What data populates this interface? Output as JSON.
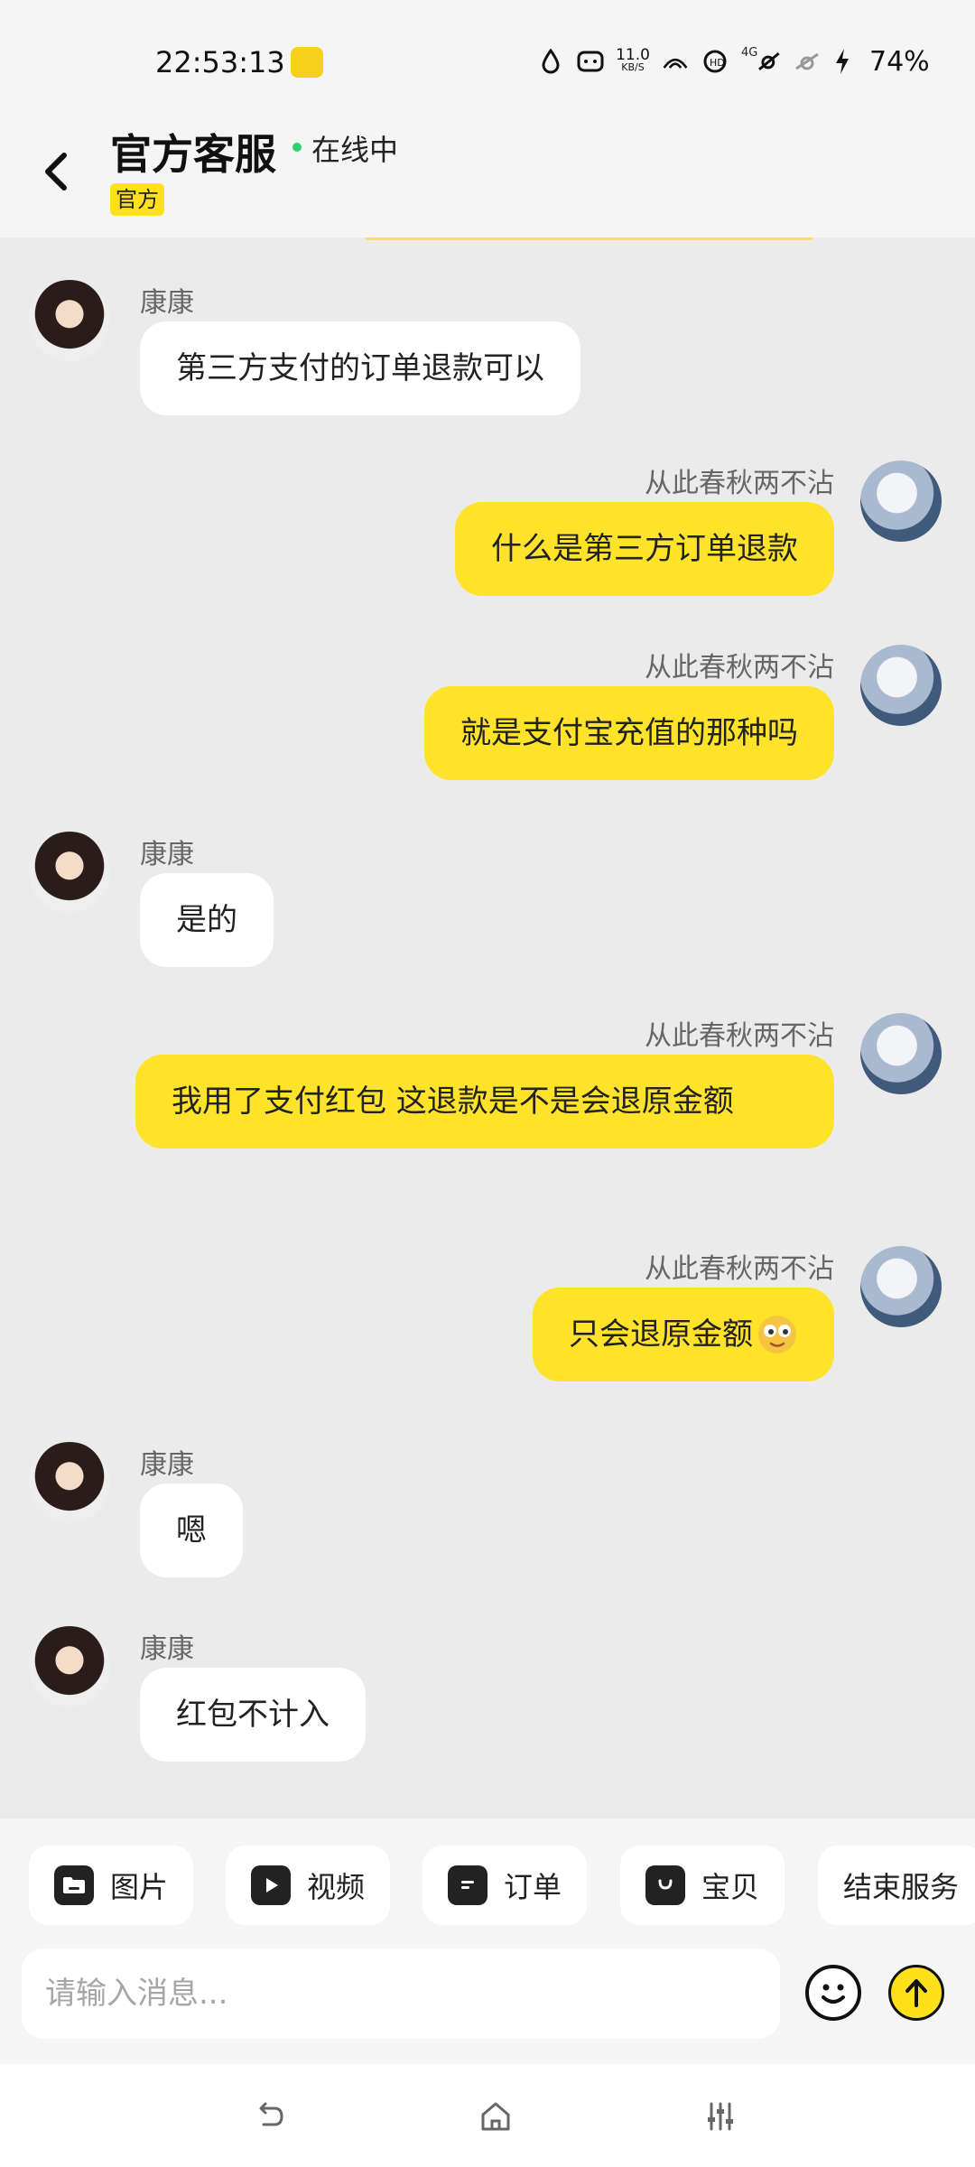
{
  "status_bar": {
    "time": "22:53:13",
    "netspeed_value": "11.0",
    "netspeed_unit": "KB/S",
    "network": "4G",
    "battery": "74%"
  },
  "header": {
    "title": "官方客服",
    "status": "在线中",
    "badge": "官方"
  },
  "messages": [
    {
      "from": "agent",
      "sender": "康康",
      "text": "第三方支付的订单退款可以"
    },
    {
      "from": "user",
      "sender": "从此春秋两不沾",
      "text": "什么是第三方订单退款"
    },
    {
      "from": "user",
      "sender": "从此春秋两不沾",
      "text": "就是支付宝充值的那种吗"
    },
    {
      "from": "agent",
      "sender": "康康",
      "text": "是的"
    },
    {
      "from": "user",
      "sender": "从此春秋两不沾",
      "text": "我用了支付红包  这退款是不是会退原金额"
    },
    {
      "from": "user",
      "sender": "从此春秋两不沾",
      "text": "只会退原金额"
    },
    {
      "from": "agent",
      "sender": "康康",
      "text": "嗯"
    },
    {
      "from": "agent",
      "sender": "康康",
      "text": "红包不计入"
    }
  ],
  "quick_actions": [
    {
      "label": "图片",
      "icon": "folder-icon"
    },
    {
      "label": "视频",
      "icon": "play-icon"
    },
    {
      "label": "订单",
      "icon": "order-icon"
    },
    {
      "label": "宝贝",
      "icon": "bag-icon"
    },
    {
      "label": "结束服务",
      "icon": ""
    }
  ],
  "input": {
    "placeholder": "请输入消息..."
  },
  "colors": {
    "accent": "#ffe11b",
    "user_bubble": "#ffe32a",
    "agent_bubble": "#ffffff",
    "chat_bg": "#ebebeb",
    "online": "#2ed26b"
  }
}
